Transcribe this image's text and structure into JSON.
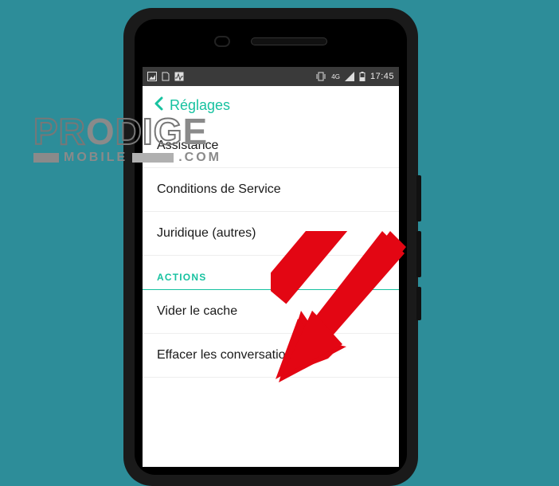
{
  "status_bar": {
    "time": "17:45",
    "network_label": "4G"
  },
  "header": {
    "title": "Réglages"
  },
  "items": [
    {
      "label": "Assistance"
    },
    {
      "label": "Conditions de Service"
    },
    {
      "label": "Juridique (autres)"
    }
  ],
  "section": {
    "title": "ACTIONS",
    "items": [
      {
        "label": "Vider le cache"
      },
      {
        "label": "Effacer les conversations"
      }
    ]
  },
  "watermark": {
    "line1_a": "PR",
    "line1_b": "DIG",
    "line1_c": "E",
    "line2": "MOBILE",
    "line2_suffix": ".COM"
  }
}
